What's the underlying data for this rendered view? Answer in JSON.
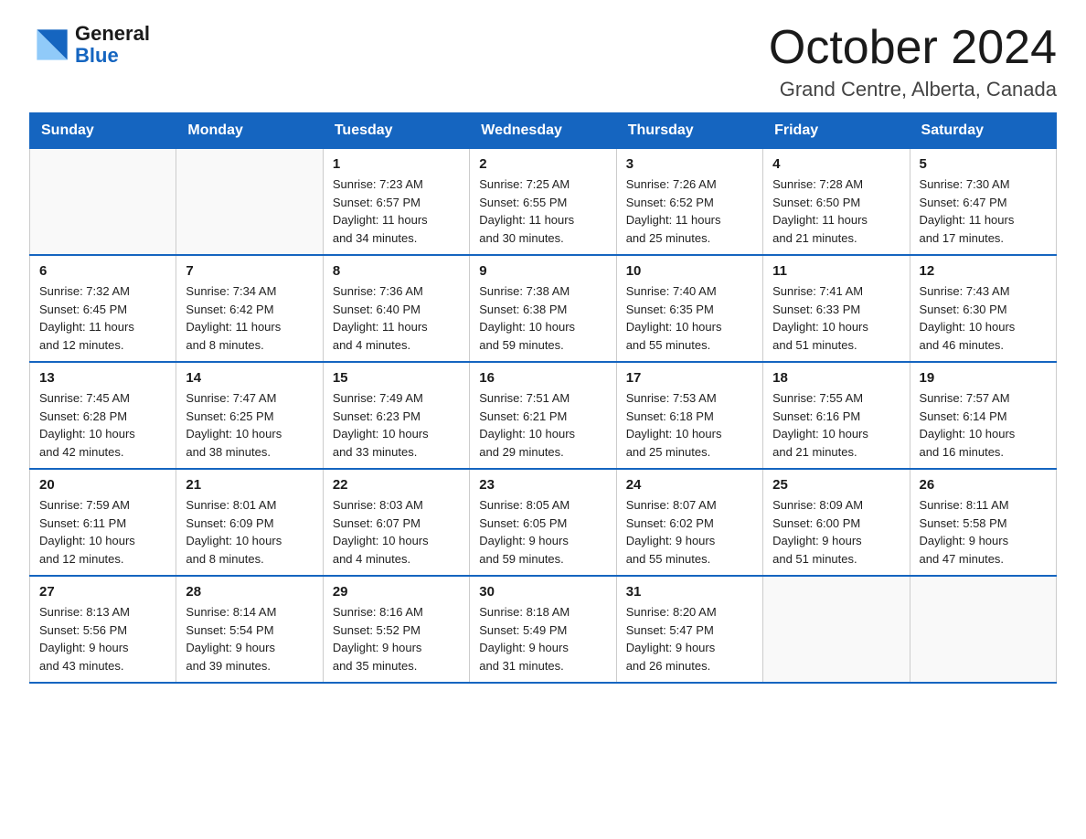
{
  "logo": {
    "general": "General",
    "blue": "Blue"
  },
  "title": "October 2024",
  "location": "Grand Centre, Alberta, Canada",
  "days_of_week": [
    "Sunday",
    "Monday",
    "Tuesday",
    "Wednesday",
    "Thursday",
    "Friday",
    "Saturday"
  ],
  "weeks": [
    [
      {
        "day": "",
        "info": ""
      },
      {
        "day": "",
        "info": ""
      },
      {
        "day": "1",
        "info": "Sunrise: 7:23 AM\nSunset: 6:57 PM\nDaylight: 11 hours\nand 34 minutes."
      },
      {
        "day": "2",
        "info": "Sunrise: 7:25 AM\nSunset: 6:55 PM\nDaylight: 11 hours\nand 30 minutes."
      },
      {
        "day": "3",
        "info": "Sunrise: 7:26 AM\nSunset: 6:52 PM\nDaylight: 11 hours\nand 25 minutes."
      },
      {
        "day": "4",
        "info": "Sunrise: 7:28 AM\nSunset: 6:50 PM\nDaylight: 11 hours\nand 21 minutes."
      },
      {
        "day": "5",
        "info": "Sunrise: 7:30 AM\nSunset: 6:47 PM\nDaylight: 11 hours\nand 17 minutes."
      }
    ],
    [
      {
        "day": "6",
        "info": "Sunrise: 7:32 AM\nSunset: 6:45 PM\nDaylight: 11 hours\nand 12 minutes."
      },
      {
        "day": "7",
        "info": "Sunrise: 7:34 AM\nSunset: 6:42 PM\nDaylight: 11 hours\nand 8 minutes."
      },
      {
        "day": "8",
        "info": "Sunrise: 7:36 AM\nSunset: 6:40 PM\nDaylight: 11 hours\nand 4 minutes."
      },
      {
        "day": "9",
        "info": "Sunrise: 7:38 AM\nSunset: 6:38 PM\nDaylight: 10 hours\nand 59 minutes."
      },
      {
        "day": "10",
        "info": "Sunrise: 7:40 AM\nSunset: 6:35 PM\nDaylight: 10 hours\nand 55 minutes."
      },
      {
        "day": "11",
        "info": "Sunrise: 7:41 AM\nSunset: 6:33 PM\nDaylight: 10 hours\nand 51 minutes."
      },
      {
        "day": "12",
        "info": "Sunrise: 7:43 AM\nSunset: 6:30 PM\nDaylight: 10 hours\nand 46 minutes."
      }
    ],
    [
      {
        "day": "13",
        "info": "Sunrise: 7:45 AM\nSunset: 6:28 PM\nDaylight: 10 hours\nand 42 minutes."
      },
      {
        "day": "14",
        "info": "Sunrise: 7:47 AM\nSunset: 6:25 PM\nDaylight: 10 hours\nand 38 minutes."
      },
      {
        "day": "15",
        "info": "Sunrise: 7:49 AM\nSunset: 6:23 PM\nDaylight: 10 hours\nand 33 minutes."
      },
      {
        "day": "16",
        "info": "Sunrise: 7:51 AM\nSunset: 6:21 PM\nDaylight: 10 hours\nand 29 minutes."
      },
      {
        "day": "17",
        "info": "Sunrise: 7:53 AM\nSunset: 6:18 PM\nDaylight: 10 hours\nand 25 minutes."
      },
      {
        "day": "18",
        "info": "Sunrise: 7:55 AM\nSunset: 6:16 PM\nDaylight: 10 hours\nand 21 minutes."
      },
      {
        "day": "19",
        "info": "Sunrise: 7:57 AM\nSunset: 6:14 PM\nDaylight: 10 hours\nand 16 minutes."
      }
    ],
    [
      {
        "day": "20",
        "info": "Sunrise: 7:59 AM\nSunset: 6:11 PM\nDaylight: 10 hours\nand 12 minutes."
      },
      {
        "day": "21",
        "info": "Sunrise: 8:01 AM\nSunset: 6:09 PM\nDaylight: 10 hours\nand 8 minutes."
      },
      {
        "day": "22",
        "info": "Sunrise: 8:03 AM\nSunset: 6:07 PM\nDaylight: 10 hours\nand 4 minutes."
      },
      {
        "day": "23",
        "info": "Sunrise: 8:05 AM\nSunset: 6:05 PM\nDaylight: 9 hours\nand 59 minutes."
      },
      {
        "day": "24",
        "info": "Sunrise: 8:07 AM\nSunset: 6:02 PM\nDaylight: 9 hours\nand 55 minutes."
      },
      {
        "day": "25",
        "info": "Sunrise: 8:09 AM\nSunset: 6:00 PM\nDaylight: 9 hours\nand 51 minutes."
      },
      {
        "day": "26",
        "info": "Sunrise: 8:11 AM\nSunset: 5:58 PM\nDaylight: 9 hours\nand 47 minutes."
      }
    ],
    [
      {
        "day": "27",
        "info": "Sunrise: 8:13 AM\nSunset: 5:56 PM\nDaylight: 9 hours\nand 43 minutes."
      },
      {
        "day": "28",
        "info": "Sunrise: 8:14 AM\nSunset: 5:54 PM\nDaylight: 9 hours\nand 39 minutes."
      },
      {
        "day": "29",
        "info": "Sunrise: 8:16 AM\nSunset: 5:52 PM\nDaylight: 9 hours\nand 35 minutes."
      },
      {
        "day": "30",
        "info": "Sunrise: 8:18 AM\nSunset: 5:49 PM\nDaylight: 9 hours\nand 31 minutes."
      },
      {
        "day": "31",
        "info": "Sunrise: 8:20 AM\nSunset: 5:47 PM\nDaylight: 9 hours\nand 26 minutes."
      },
      {
        "day": "",
        "info": ""
      },
      {
        "day": "",
        "info": ""
      }
    ]
  ]
}
